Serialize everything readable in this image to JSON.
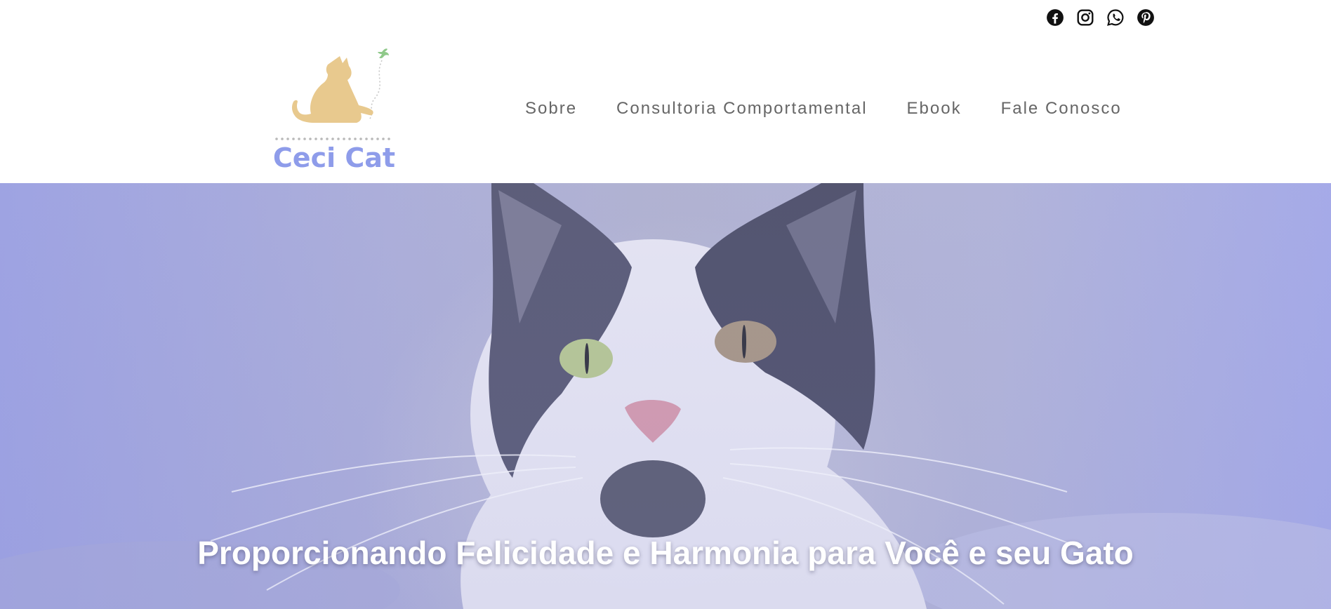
{
  "social": {
    "icons": [
      "facebook-icon",
      "instagram-icon",
      "whatsapp-icon",
      "pinterest-icon"
    ]
  },
  "logo": {
    "text": "Ceci Cat",
    "colors": {
      "cat": "#e8c98e",
      "text": "#8e9cea",
      "bird": "#8fc98a",
      "dots": "#b8b8b8"
    }
  },
  "nav": {
    "items": [
      "Sobre",
      "Consultoria Comportamental",
      "Ebook",
      "Fale Conosco"
    ]
  },
  "hero": {
    "title": "Proporcionando Felicidade e Harmonia para Você e seu Gato"
  },
  "colors": {
    "nav_text": "#666666",
    "hero_overlay": "#a3a8e8",
    "hero_text": "#ffffff"
  }
}
